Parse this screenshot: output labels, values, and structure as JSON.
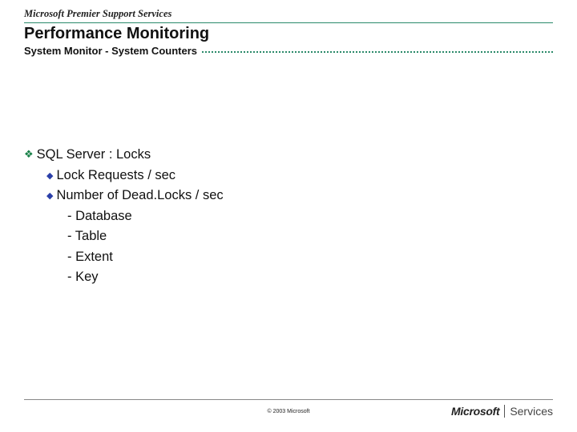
{
  "header": {
    "brand": "Microsoft Premier Support Services",
    "title": "Performance Monitoring",
    "subtitle": "System Monitor - System Counters"
  },
  "content": {
    "section": "SQL Server : Locks",
    "items": [
      "Lock Requests / sec",
      "Number of Dead.Locks / sec"
    ],
    "subitems": [
      "- Database",
      "- Table",
      "- Extent",
      "- Key"
    ]
  },
  "footer": {
    "copyright": "© 2003 Microsoft",
    "logo_main": "Microsoft",
    "logo_sub": "Services"
  }
}
